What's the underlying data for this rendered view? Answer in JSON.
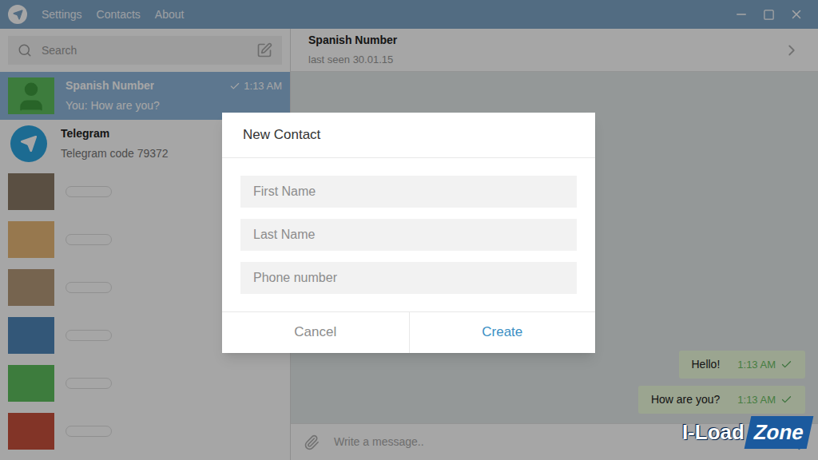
{
  "window": {
    "menu": [
      "Settings",
      "Contacts",
      "About"
    ]
  },
  "search": {
    "placeholder": "Search"
  },
  "chats": [
    {
      "kind": "contact",
      "name": "Spanish Number",
      "preview": "You: How are you?",
      "time": "1:13 AM",
      "sent": true,
      "selected": true,
      "color": "#5fbf5f"
    },
    {
      "kind": "service",
      "name": "Telegram",
      "preview": "Telegram code 79372",
      "sent": false,
      "selected": false,
      "color": "#2ca5e0"
    },
    {
      "kind": "redacted",
      "sent": false,
      "selected": false,
      "color": "#8a7a66"
    },
    {
      "kind": "redacted",
      "sent": false,
      "selected": false,
      "color": "#e8b878"
    },
    {
      "kind": "redacted",
      "sent": false,
      "selected": false,
      "color": "#b59a7a"
    },
    {
      "kind": "redacted",
      "sent": false,
      "selected": false,
      "color": "#4f86b8"
    },
    {
      "kind": "redacted",
      "sent": false,
      "selected": false,
      "color": "#5fbf5f"
    },
    {
      "kind": "redacted",
      "sent": false,
      "selected": false,
      "color": "#c8503c"
    }
  ],
  "chat": {
    "name": "Spanish Number",
    "status": "last seen 30.01.15",
    "messages": [
      {
        "text": "Hello!",
        "time": "1:13 AM",
        "sent": true
      },
      {
        "text": "How are you?",
        "time": "1:13 AM",
        "sent": true
      }
    ],
    "composer": {
      "placeholder": "Write a message.."
    }
  },
  "dialog": {
    "title": "New Contact",
    "fields": [
      {
        "placeholder": "First Name"
      },
      {
        "placeholder": "Last Name"
      },
      {
        "placeholder": "Phone number"
      }
    ],
    "buttons": [
      {
        "label": "Cancel",
        "primary": false
      },
      {
        "label": "Create",
        "primary": true
      }
    ]
  },
  "watermark": {
    "parts": [
      "I-Load",
      "Zone"
    ]
  }
}
